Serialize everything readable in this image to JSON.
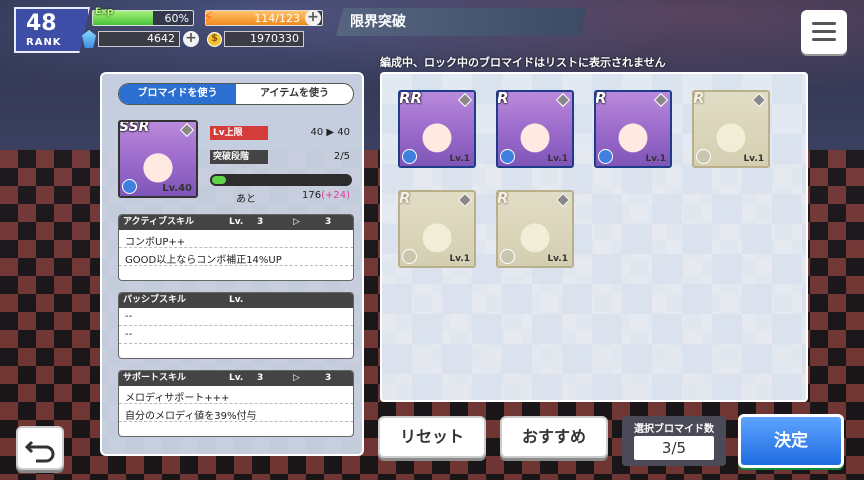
{
  "header": {
    "rank_number": "48",
    "rank_label": "RANK",
    "exp_label": "Exp",
    "exp_percent_text": "60%",
    "exp_fraction": 0.6,
    "stamina_text": "114/123",
    "stamina_fraction": 0.927,
    "gems": "4642",
    "coins": "1970330",
    "title": "限界突破"
  },
  "notice": "編成中、ロック中のブロマイドはリストに表示されません",
  "tabs": [
    "ブロマイドを使う",
    "アイテムを使う"
  ],
  "character": {
    "rarity": "SSR",
    "level": "Lv.40"
  },
  "stats": {
    "lv_cap_label": "Lv上限",
    "lv_cap_value": "40 ▶ 40",
    "stage_label": "突破段階",
    "stage_value": "2/5",
    "progress_fraction": 0.1,
    "remain_label": "あと",
    "remain_value": "176",
    "remain_bonus": "(+24)"
  },
  "skills": [
    {
      "header": "アクティブスキル",
      "lv_label": "Lv.",
      "lv_from": "3",
      "lv_to": "3",
      "name": "コンボUP++",
      "desc": "GOOD以上ならコンボ補正14%UP"
    },
    {
      "header": "パッシブスキル",
      "lv_label": "Lv.",
      "lv_from": "",
      "lv_to": "",
      "name": "--",
      "desc": "--"
    },
    {
      "header": "サポートスキル",
      "lv_label": "Lv.",
      "lv_from": "3",
      "lv_to": "3",
      "name": "メロディサポート+++",
      "desc": "自分のメロディ値を39%付与"
    }
  ],
  "cards": [
    {
      "rarity": "RR",
      "level": "Lv.1",
      "dim": false
    },
    {
      "rarity": "R",
      "level": "Lv.1",
      "dim": false
    },
    {
      "rarity": "R",
      "level": "Lv.1",
      "dim": false
    },
    {
      "rarity": "R",
      "level": "Lv.1",
      "dim": true
    },
    {
      "rarity": "R",
      "level": "Lv.1",
      "dim": true
    },
    {
      "rarity": "R",
      "level": "Lv.1",
      "dim": true
    }
  ],
  "buttons": {
    "reset": "リセット",
    "recommend": "おすすめ",
    "decide": "決定"
  },
  "selection": {
    "label": "選択ブロマイド数",
    "value": "3/5"
  }
}
